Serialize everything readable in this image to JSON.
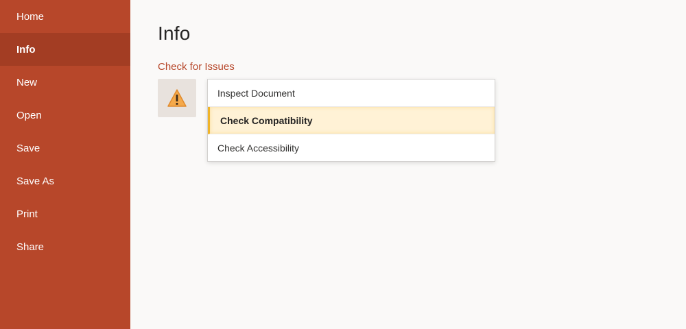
{
  "sidebar": {
    "items": [
      {
        "label": "Home"
      },
      {
        "label": "Info"
      },
      {
        "label": "New"
      },
      {
        "label": "Open"
      },
      {
        "label": "Save"
      },
      {
        "label": "Save As"
      },
      {
        "label": "Print"
      },
      {
        "label": "Share"
      }
    ],
    "active_index": 1
  },
  "main": {
    "title": "Info",
    "section_title": "Check for Issues",
    "issue_icon": "warning-icon"
  },
  "dropdown": {
    "items": [
      {
        "label": "Inspect Document"
      },
      {
        "label": "Check Compatibility"
      },
      {
        "label": "Check Accessibility"
      }
    ],
    "highlighted_index": 1
  },
  "colors": {
    "sidebar_bg": "#b7472a",
    "sidebar_active_bg": "#a33d23",
    "accent": "#b7472a",
    "highlight_bg": "#fff2d6",
    "highlight_border": "#f0b429",
    "warning_fill": "#f5a94a"
  }
}
